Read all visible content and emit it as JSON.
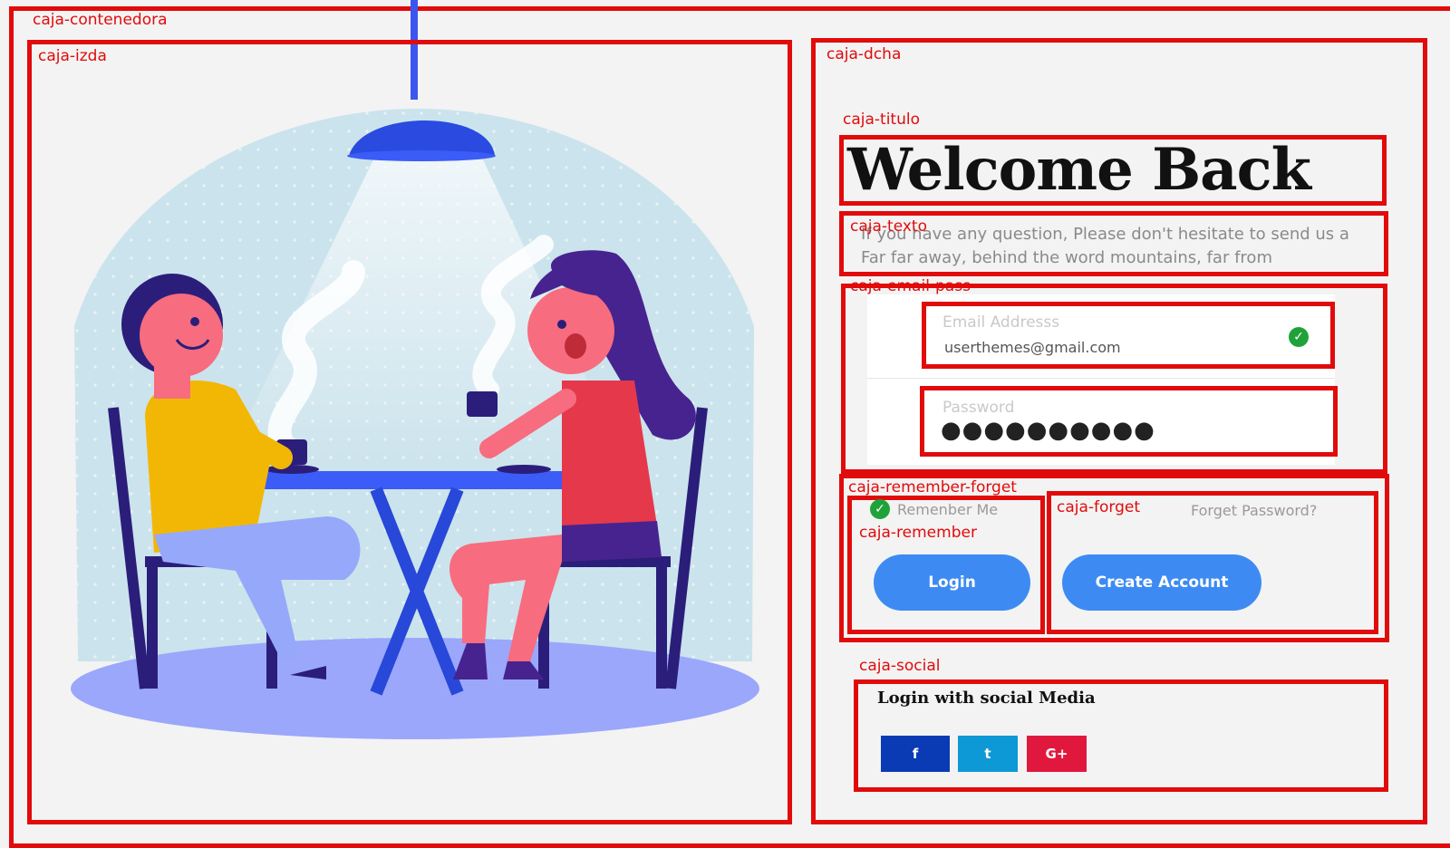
{
  "labels": {
    "contenedora": "caja-contenedora",
    "izda": "caja-izda",
    "dcha": "caja-dcha",
    "titulo": "caja-titulo",
    "texto": "caja-texto",
    "email_pass": "caja-email-pass",
    "remember_forget": "caja-remember-forget",
    "forget": "caja-forget",
    "remember": "caja-remember",
    "social": "caja-social"
  },
  "title": "Welcome Back",
  "description": {
    "line1": "If you have any question, Please don't hesitate to send us a",
    "line2": "Far far away, behind the word mountains, far from"
  },
  "email": {
    "placeholder": "Email Addresss",
    "value": "userthemes@gmail.com"
  },
  "password": {
    "placeholder": "Password",
    "value": "●●●●●●●●●●"
  },
  "remember_label": "Remenber Me",
  "forget_label": "Forget Password?",
  "buttons": {
    "login": "Login",
    "create": "Create Account"
  },
  "social": {
    "title": "Login with social Media",
    "facebook": "f",
    "twitter": "t",
    "google": "G+"
  },
  "colors": {
    "outline": "#e10b0b",
    "button": "#3d8bf2",
    "facebook": "#0a3bb5",
    "twitter": "#0d98d6",
    "google": "#e1183e",
    "check": "#1fa23a"
  },
  "icons": {
    "email_status": "check-circle-icon",
    "remember": "check-circle-icon",
    "facebook": "facebook-icon",
    "twitter": "twitter-icon",
    "google": "google-plus-icon"
  }
}
